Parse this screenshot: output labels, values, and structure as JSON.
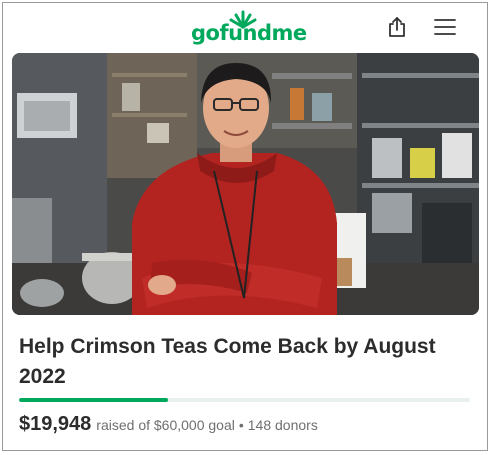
{
  "header": {
    "logo_text": "gofundme",
    "share_icon": "share-icon",
    "menu_icon": "hamburger-menu-icon"
  },
  "campaign": {
    "photo": "man-in-red-sweater-arms-crossed-in-tea-shop-kitchen",
    "title": "Help Crimson Teas Come Back by August 2022",
    "amount_raised": "$19,948",
    "raised_text": "raised of $60,000 goal",
    "separator": "•",
    "donors_text": "148 donors",
    "progress_fraction": 0.33
  },
  "colors": {
    "brand": "#02a95c",
    "title": "#2c2c2c",
    "muted": "#6f6f6f"
  }
}
